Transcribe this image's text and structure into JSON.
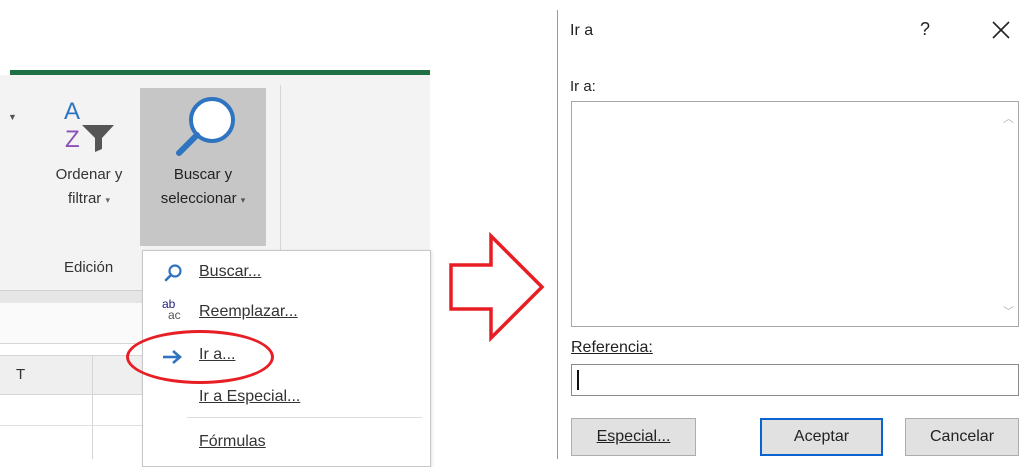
{
  "ribbon": {
    "sort_label_1": "Ordenar y",
    "sort_label_2": "filtrar",
    "find_label_1": "Buscar y",
    "find_label_2": "seleccionar",
    "group_label": "Edición",
    "column_header": "T",
    "sort_icon_letters": [
      "A",
      "Z"
    ]
  },
  "menu": {
    "items": [
      {
        "label": "Buscar...",
        "icon": "search-icon"
      },
      {
        "label": "Reemplazar...",
        "icon": "replace-icon",
        "icon_text_top": "ab",
        "icon_text_bottom": "ac"
      },
      {
        "label": "Ir a...",
        "icon": "arrow-right-icon"
      },
      {
        "label": "Ir a Especial...",
        "icon": ""
      },
      {
        "label": "Fórmulas",
        "icon": ""
      }
    ]
  },
  "dialog": {
    "title": "Ir a",
    "help": "?",
    "ir_a_label": "Ir a:",
    "reference_label": "Referencia:",
    "reference_value": "",
    "buttons": {
      "special": "Especial...",
      "ok": "Aceptar",
      "cancel": "Cancelar"
    }
  },
  "colors": {
    "ribbon_accent": "#1e7145",
    "highlight_red": "#e81e25",
    "default_button_border": "#0a63cf",
    "icon_blue": "#2f74c0",
    "icon_purple": "#8a52b8"
  }
}
